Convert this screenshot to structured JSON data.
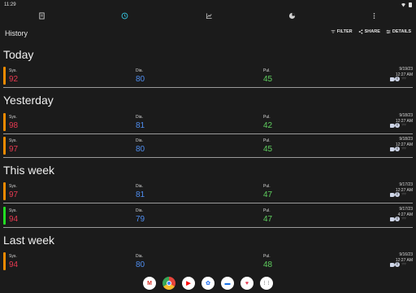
{
  "status": {
    "time": "11:29"
  },
  "tabs": [
    {
      "icon": "notepad-icon",
      "active": false
    },
    {
      "icon": "clock-icon",
      "active": true
    },
    {
      "icon": "chart-icon",
      "active": false
    },
    {
      "icon": "pie-icon",
      "active": false
    }
  ],
  "toolbar": {
    "title": "History",
    "filter_label": "FILTER",
    "share_label": "SHARE",
    "details_label": "DETAILS"
  },
  "labels": {
    "sys": "Sys.",
    "dia": "Dia.",
    "pul": "Pul."
  },
  "colors": {
    "accent": "#36c6e0",
    "sys": "#e53950",
    "dia": "#4f8ef0",
    "pul": "#5fcf5f",
    "bar_orange": "#f08a00",
    "bar_green": "#22dd22"
  },
  "sections": [
    {
      "title": "Today",
      "rows": [
        {
          "sys": "92",
          "dia": "80",
          "pul": "45",
          "date": "9/19/23",
          "time": "12:27 AM",
          "bar": "orange"
        }
      ]
    },
    {
      "title": "Yesterday",
      "rows": [
        {
          "sys": "98",
          "dia": "81",
          "pul": "42",
          "date": "9/18/23",
          "time": "12:27 AM",
          "bar": "orange"
        },
        {
          "sys": "97",
          "dia": "80",
          "pul": "45",
          "date": "9/18/23",
          "time": "12:27 AM",
          "bar": "orange"
        }
      ]
    },
    {
      "title": "This week",
      "rows": [
        {
          "sys": "97",
          "dia": "81",
          "pul": "47",
          "date": "9/17/23",
          "time": "12:27 AM",
          "bar": "orange"
        },
        {
          "sys": "94",
          "dia": "79",
          "pul": "47",
          "date": "9/17/23",
          "time": "4:27 AM",
          "bar": "green"
        }
      ]
    },
    {
      "title": "Last week",
      "rows": [
        {
          "sys": "94",
          "dia": "80",
          "pul": "48",
          "date": "9/16/23",
          "time": "12:27 AM",
          "bar": "orange"
        }
      ]
    }
  ],
  "dock": [
    {
      "icon": "gmail-icon",
      "glyph": "M",
      "bg": "#ffffff",
      "fg": "#d93025"
    },
    {
      "icon": "chrome-icon",
      "glyph": "",
      "bg": "#e8453c",
      "fg": "#ffffff"
    },
    {
      "icon": "youtube-icon",
      "glyph": "▶",
      "bg": "#ffffff",
      "fg": "#ff0000"
    },
    {
      "icon": "photos-icon",
      "glyph": "✿",
      "bg": "#ffffff",
      "fg": "#4285f4"
    },
    {
      "icon": "messages-icon",
      "glyph": "▬",
      "bg": "#ffffff",
      "fg": "#1a73e8"
    },
    {
      "icon": "health-app-icon",
      "glyph": "♥",
      "bg": "#ffffff",
      "fg": "#e53950"
    },
    {
      "icon": "app-drawer-icon",
      "glyph": "⋮⋮",
      "bg": "#ffffff",
      "fg": "#333333"
    }
  ]
}
